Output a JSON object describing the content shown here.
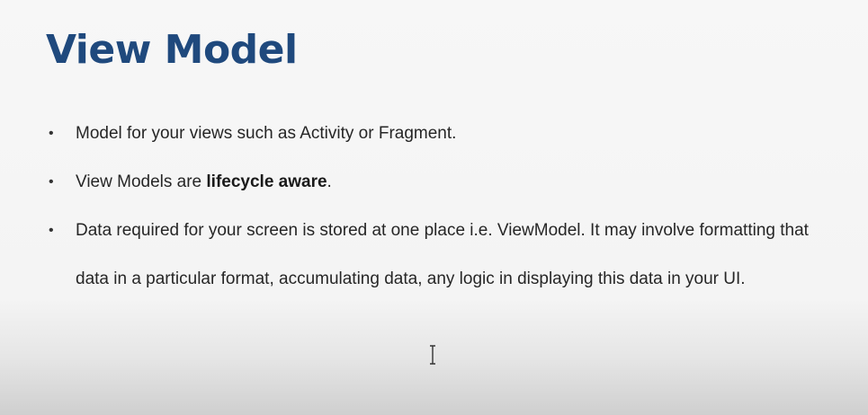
{
  "slide": {
    "title": "View Model",
    "bullets": [
      {
        "text": "Model for your views such as Activity or Fragment."
      },
      {
        "text_before": "View Models are ",
        "text_bold": "lifecycle aware",
        "text_after": "."
      },
      {
        "text": "Data required for your screen is stored at one place i.e. ViewModel. It may involve formatting that data in a particular format, accumulating data, any logic in displaying this data in your UI."
      }
    ],
    "bullet_symbol": "•"
  },
  "colors": {
    "title": "#1f497d",
    "body_text": "#262626",
    "background": "#f4f4f4"
  },
  "cursor": {
    "icon": "text-cursor-icon"
  }
}
